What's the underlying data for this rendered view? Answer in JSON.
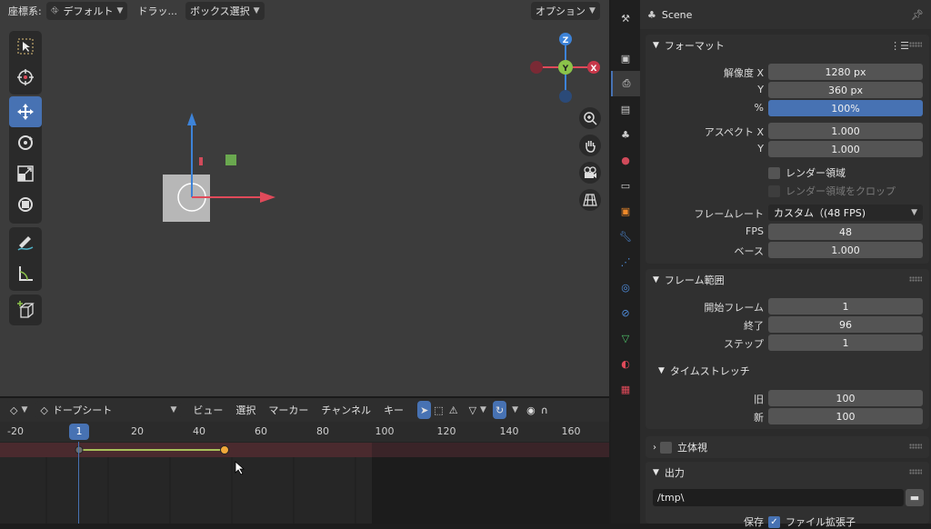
{
  "viewport": {
    "header": {
      "orientation_label": "座標系:",
      "orientation_value": "デフォルト",
      "drag_label": "ドラッ...",
      "select_mode": "ボックス選択",
      "options": "オプション"
    },
    "gizmo": {
      "z": "Z",
      "y": "Y",
      "x": "X"
    }
  },
  "dopesheet": {
    "mode": "ドープシート",
    "menus": [
      "ビュー",
      "選択",
      "マーカー",
      "チャンネル",
      "キー"
    ],
    "ticks": [
      "-20",
      "20",
      "40",
      "60",
      "80",
      "100",
      "120",
      "140",
      "160"
    ],
    "current_frame": "1"
  },
  "properties": {
    "scene_name": "Scene",
    "format": {
      "title": "フォーマット",
      "resolution_x_label": "解像度 X",
      "resolution_x": "1280 px",
      "resolution_y_label": "Y",
      "resolution_y": "360 px",
      "percent_label": "%",
      "percent": "100%",
      "aspect_x_label": "アスペクト X",
      "aspect_x": "1.000",
      "aspect_y_label": "Y",
      "aspect_y": "1.000",
      "render_region": "レンダー領域",
      "crop_region": "レンダー領域をクロップ",
      "framerate_label": "フレームレート",
      "framerate": "カスタム（(48 FPS)",
      "fps_label": "FPS",
      "fps": "48",
      "base_label": "ベース",
      "base": "1.000"
    },
    "frame_range": {
      "title": "フレーム範囲",
      "start_label": "開始フレーム",
      "start": "1",
      "end_label": "終了",
      "end": "96",
      "step_label": "ステップ",
      "step": "1"
    },
    "time_stretch": {
      "title": "タイムストレッチ",
      "old_label": "旧",
      "old": "100",
      "new_label": "新",
      "new": "100"
    },
    "stereoscopy": {
      "title": "立体視"
    },
    "output": {
      "title": "出力",
      "path": "/tmp\\",
      "save_label": "保存",
      "file_ext": "ファイル拡張子"
    }
  },
  "colors": {
    "accent": "#4772b3",
    "keyframe": "#f0a83a",
    "x_axis": "#e04a5a",
    "y_axis": "#8bc34a",
    "z_axis": "#3d83d8"
  }
}
